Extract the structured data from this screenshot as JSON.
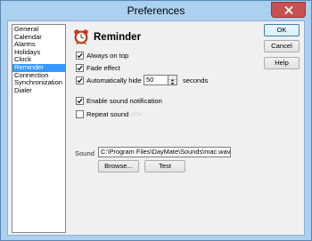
{
  "window": {
    "title": "Preferences"
  },
  "nav": {
    "items": [
      {
        "label": "General"
      },
      {
        "label": "Calendar"
      },
      {
        "label": "Alarms"
      },
      {
        "label": "Holidays"
      },
      {
        "label": "Clock"
      },
      {
        "label": "Reminder",
        "selected": true
      },
      {
        "label": "Connection"
      },
      {
        "label": "Synchronization"
      },
      {
        "label": "Dialer"
      }
    ]
  },
  "panel": {
    "title": "Reminder",
    "icon": "alarm-clock-icon",
    "options": {
      "always_on_top": {
        "label": "Always on top",
        "checked": true
      },
      "fade_effect": {
        "label": "Fade effect",
        "checked": true
      },
      "auto_hide": {
        "label": "Automatically hide in",
        "checked": true,
        "value": "50",
        "unit": "seconds"
      },
      "enable_sound": {
        "label": "Enable sound notification",
        "checked": true
      },
      "repeat_sound": {
        "label": "Repeat sound",
        "checked": false,
        "extra": "once"
      }
    },
    "sound": {
      "label": "Sound",
      "path": "C:\\Program Files\\DayMate\\Sounds\\mac.wav",
      "browse_label": "Browse...",
      "test_label": "Test"
    }
  },
  "buttons": {
    "ok": "OK",
    "cancel": "Cancel",
    "help": "Help"
  },
  "colors": {
    "selection": "#3399ff",
    "close_button": "#c75050",
    "frame": "#abd0f0"
  }
}
